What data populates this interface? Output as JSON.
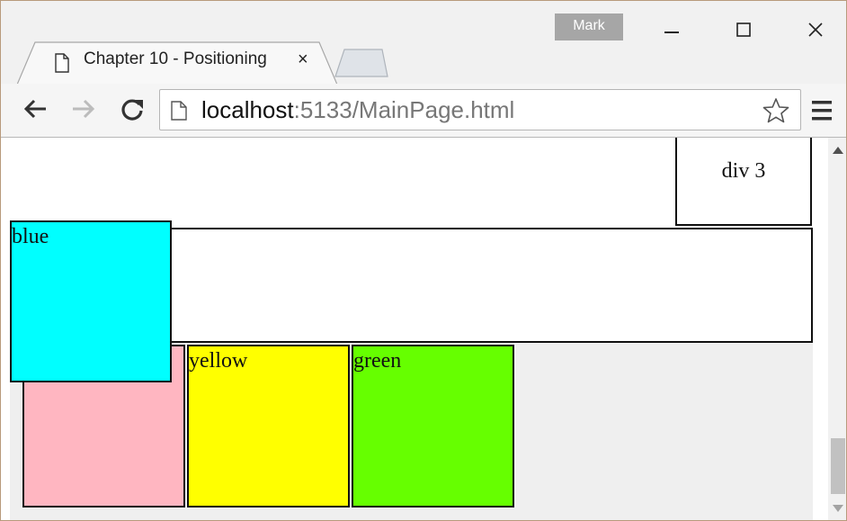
{
  "window": {
    "profile_name": "Mark",
    "controls": {
      "minimize": "minimize-icon",
      "maximize": "maximize-icon",
      "close": "close-icon"
    }
  },
  "tab": {
    "title": "Chapter 10 - Positioning",
    "close_glyph": "×",
    "icon": "document-icon"
  },
  "toolbar": {
    "back_icon": "back-arrow-icon",
    "forward_icon": "forward-arrow-icon",
    "reload_icon": "reload-icon",
    "url_host": "localhost",
    "url_rest": ":5133/MainPage.html",
    "bookmark_icon": "star-icon",
    "menu_icon": "hamburger-menu-icon"
  },
  "page": {
    "div3_label": "div 3",
    "blue_label": "blue",
    "yellow_label": "yellow",
    "green_label": "green",
    "colors": {
      "blue": "#00ffff",
      "pink": "#ffb6c1",
      "yellow": "#ffff00",
      "green": "#66ff00"
    }
  }
}
